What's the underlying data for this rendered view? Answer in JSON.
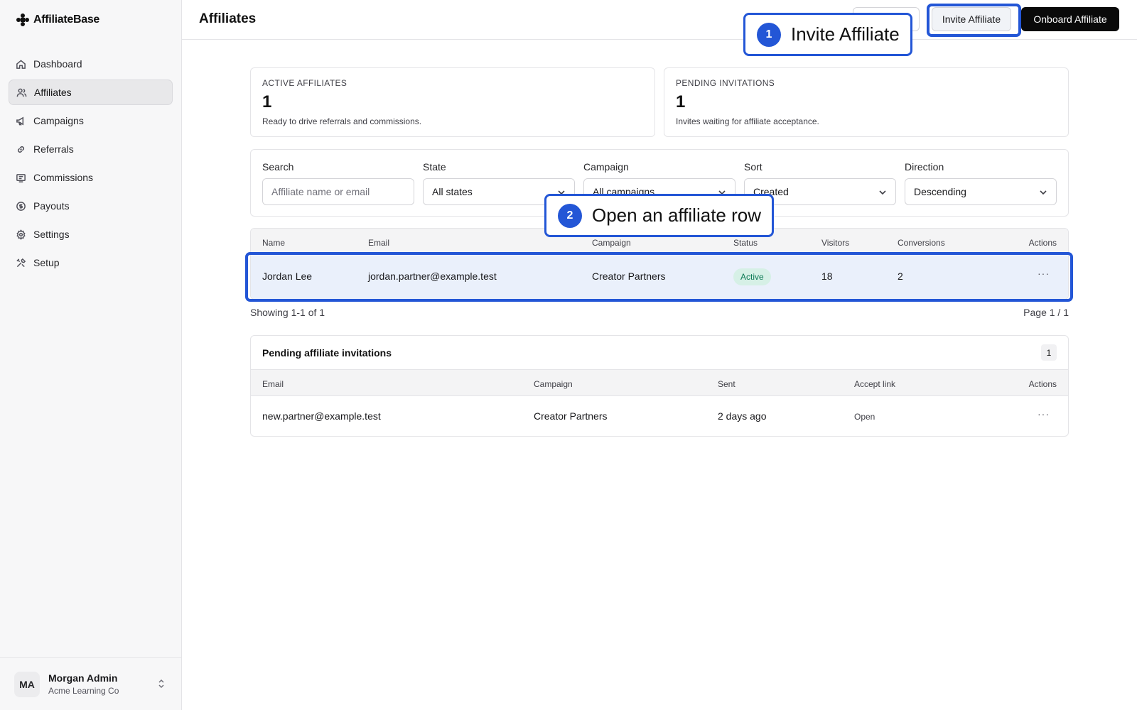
{
  "app": {
    "name": "AffiliateBase"
  },
  "sidebar": {
    "items": [
      {
        "label": "Dashboard",
        "icon": "home-icon"
      },
      {
        "label": "Affiliates",
        "icon": "users-icon",
        "active": true
      },
      {
        "label": "Campaigns",
        "icon": "megaphone-icon"
      },
      {
        "label": "Referrals",
        "icon": "link-icon"
      },
      {
        "label": "Commissions",
        "icon": "receipt-icon"
      },
      {
        "label": "Payouts",
        "icon": "dollar-circle-icon"
      },
      {
        "label": "Settings",
        "icon": "gear-icon"
      },
      {
        "label": "Setup",
        "icon": "tools-icon"
      }
    ],
    "user": {
      "initials": "MA",
      "name": "Morgan Admin",
      "org": "Acme Learning Co"
    }
  },
  "header": {
    "title": "Affiliates",
    "csv_label": "V",
    "invite_label": "Invite Affiliate",
    "onboard_label": "Onboard Affiliate"
  },
  "stats": [
    {
      "label": "ACTIVE AFFILIATES",
      "value": "1",
      "desc": "Ready to drive referrals and commissions."
    },
    {
      "label": "PENDING INVITATIONS",
      "value": "1",
      "desc": "Invites waiting for affiliate acceptance."
    }
  ],
  "filters": {
    "search": {
      "label": "Search",
      "placeholder": "Affiliate name or email"
    },
    "state": {
      "label": "State",
      "value": "All states"
    },
    "campaign": {
      "label": "Campaign",
      "value": "All campaigns"
    },
    "sort": {
      "label": "Sort",
      "value": "Created"
    },
    "direction": {
      "label": "Direction",
      "value": "Descending"
    }
  },
  "affiliates_table": {
    "columns": [
      "Name",
      "Email",
      "Campaign",
      "Status",
      "Visitors",
      "Conversions",
      "Actions"
    ],
    "rows": [
      {
        "name": "Jordan Lee",
        "email": "jordan.partner@example.test",
        "campaign": "Creator Partners",
        "status": "Active",
        "visitors": "18",
        "conversions": "2",
        "actions": "···"
      }
    ],
    "showing": "Showing 1-1 of 1",
    "page": "Page 1 / 1"
  },
  "invitations": {
    "title": "Pending affiliate invitations",
    "count": "1",
    "columns": [
      "Email",
      "Campaign",
      "Sent",
      "Accept link",
      "Actions"
    ],
    "rows": [
      {
        "email": "new.partner@example.test",
        "campaign": "Creator Partners",
        "sent": "2 days ago",
        "link": "Open",
        "actions": "···"
      }
    ]
  },
  "callouts": [
    {
      "num": "1",
      "text": "Invite Affiliate"
    },
    {
      "num": "2",
      "text": "Open an affiliate row"
    }
  ],
  "colors": {
    "accent": "#2356d6",
    "active_badge_bg": "#d6f0e6",
    "active_badge_text": "#0d7a55"
  }
}
